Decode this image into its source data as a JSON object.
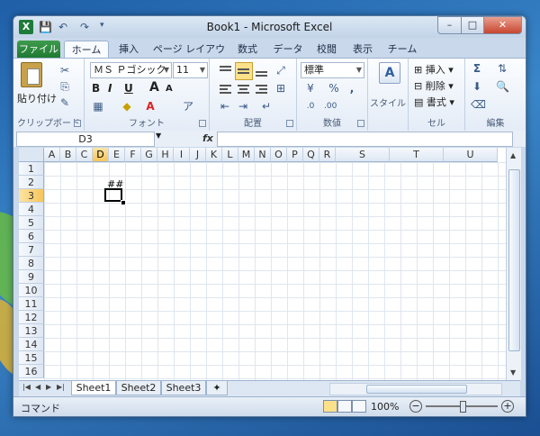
{
  "window": {
    "title": "Book1 - Microsoft Excel",
    "app_icon": "X",
    "controls": {
      "min": "–",
      "max": "□",
      "close": "✕"
    }
  },
  "qat": {
    "save": "💾",
    "undo": "↶",
    "redo": "↷"
  },
  "tabs": [
    "ファイル",
    "ホーム",
    "挿入",
    "ページ レイアウト",
    "数式",
    "データ",
    "校閲",
    "表示",
    "チーム"
  ],
  "help_icon": "?",
  "ribbon": {
    "clipboard": {
      "label": "クリップボード",
      "paste": "貼り付け"
    },
    "font": {
      "label": "フォント",
      "name": "ＭＳ Ｐゴシック",
      "size": "11",
      "bold": "B",
      "italic": "I",
      "underline": "U",
      "grow": "A",
      "shrink": "A"
    },
    "alignment": {
      "label": "配置"
    },
    "number": {
      "label": "数値",
      "format": "標準",
      "percent": "%",
      "comma": ","
    },
    "styles": {
      "label": "スタイル"
    },
    "cells": {
      "label": "セル",
      "insert": "挿入",
      "delete": "削除",
      "format": "書式"
    },
    "editing": {
      "label": "編集",
      "sigma": "Σ"
    }
  },
  "formula_bar": {
    "name_box": "D3",
    "fx": "fx",
    "formula": ""
  },
  "grid": {
    "columns": [
      "A",
      "B",
      "C",
      "D",
      "E",
      "F",
      "G",
      "H",
      "I",
      "J",
      "K",
      "L",
      "M",
      "N",
      "O",
      "P",
      "Q",
      "R",
      "S",
      "T",
      "U"
    ],
    "selected_column": "D",
    "rows": [
      "1",
      "2",
      "3",
      "4",
      "5",
      "6",
      "7",
      "8",
      "9",
      "10",
      "11",
      "12",
      "13",
      "14",
      "15",
      "16"
    ],
    "selected_row": "3",
    "cell_D2": "##"
  },
  "sheets": [
    "Sheet1",
    "Sheet2",
    "Sheet3"
  ],
  "active_sheet": "Sheet1",
  "status": {
    "mode": "コマンド",
    "zoom": "100%",
    "zoom_out": "−",
    "zoom_in": "+"
  }
}
